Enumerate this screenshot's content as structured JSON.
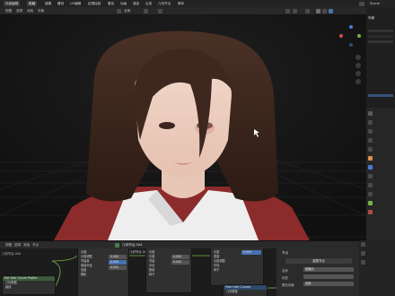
{
  "topbar": {
    "tabs": [
      "布局编辑",
      "布局",
      "建模",
      "雕刻",
      "UV编辑",
      "纹理绘制",
      "着色",
      "动画",
      "渲染",
      "合成",
      "几何节点",
      "脚本"
    ],
    "active_tab_index": 1,
    "scene_label": "Scene"
  },
  "viewport_header": {
    "menus": [
      "视图",
      "选择",
      "添加",
      "对象"
    ],
    "mode": "全局",
    "transform": "几何节点"
  },
  "outliner": {
    "title": "场景"
  },
  "node_editor": {
    "header_items": [
      "视图",
      "选择",
      "添加",
      "节点"
    ],
    "object_label": "几何节点.004",
    "tree_name": "几何节点.004",
    "nodes": [
      {
        "title": "Set Hair Curve Profile",
        "rows": [
          "几何数据",
          "曲线",
          "半径"
        ]
      },
      {
        "title": "几何数据",
        "rows": [
          "长度",
          "长度调整",
          "弯曲量",
          "卷曲半径",
          "密度",
          "随机"
        ]
      },
      {
        "title": "几何数据",
        "rows": [
          "长度",
          "长度",
          "弯曲",
          "半径",
          "数量",
          "种子"
        ]
      },
      {
        "title": "几何数据",
        "rows": [
          "长度",
          "密度",
          "长度调整",
          "半径",
          "种子"
        ]
      },
      {
        "title": "Trim Hair Curves",
        "rows": [
          "几何数据"
        ]
      }
    ],
    "values": [
      "0.000",
      "0.000",
      "0.000",
      "0.000",
      "0.000",
      "0.000"
    ]
  },
  "n_panel": {
    "title": "节点",
    "reset_label": "重置节点",
    "name_label": "名称",
    "name_value": "组输出",
    "label_label": "标签",
    "parent_label": "警告传播",
    "parent_value": "全部"
  },
  "colors": {
    "accent": "#4772b3",
    "node_header_green": "#3b5b3b",
    "node_header_blue": "#2e4a6b",
    "gizmo_x": "#d94a4a",
    "gizmo_y": "#7ab34a",
    "gizmo_z": "#4a7ad9"
  }
}
